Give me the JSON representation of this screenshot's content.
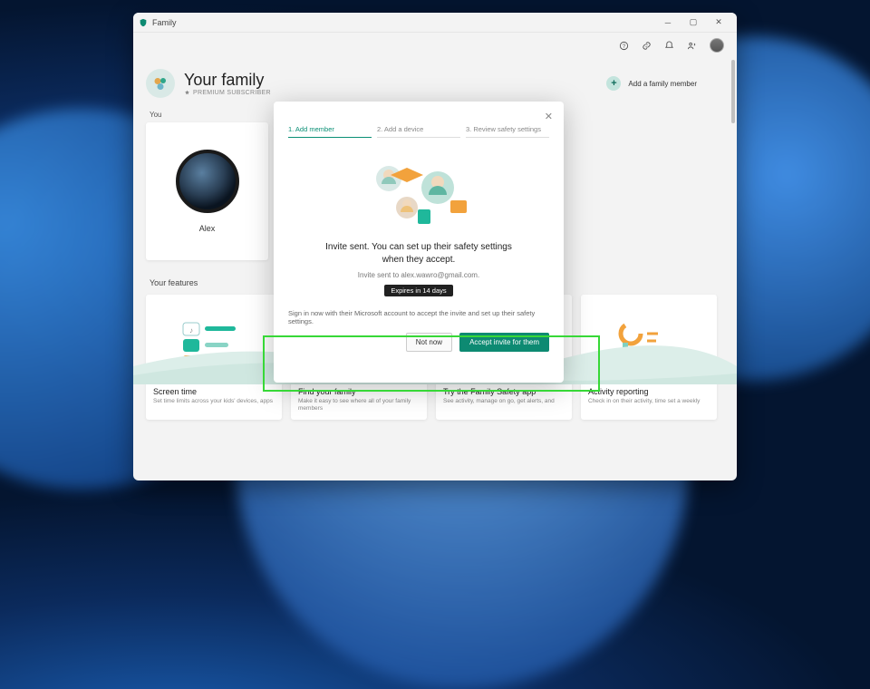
{
  "window": {
    "title": "Family"
  },
  "header": {
    "title": "Your family",
    "subtitle": "PREMIUM SUBSCRIBER",
    "add_label": "Add a family member"
  },
  "you": {
    "section_label": "You",
    "name": "Alex"
  },
  "features": {
    "section_label": "Your features",
    "cards": [
      {
        "title": "Screen time",
        "desc": "Set time limits across your kids' devices, apps"
      },
      {
        "title": "Find your family",
        "desc": "Make it easy to see where all of your family members"
      },
      {
        "title": "Try the Family Safety app",
        "desc": "See activity, manage on go, get alerts, and"
      },
      {
        "title": "Activity reporting",
        "desc": "Check in on their activity, time set a weekly"
      }
    ]
  },
  "modal": {
    "steps": [
      "1. Add member",
      "2. Add a device",
      "3. Review safety settings"
    ],
    "active_step": 0,
    "title_line1": "Invite sent. You can set up their safety settings",
    "title_line2": "when they accept.",
    "sent_to": "Invite sent to alex.wawro@gmail.com.",
    "expiry": "Expires in 14 days",
    "signin_hint": "Sign in now with their Microsoft account to accept the invite and set up their safety settings.",
    "not_now": "Not now",
    "accept": "Accept invite for them"
  },
  "colors": {
    "accent": "#0d8a72"
  }
}
